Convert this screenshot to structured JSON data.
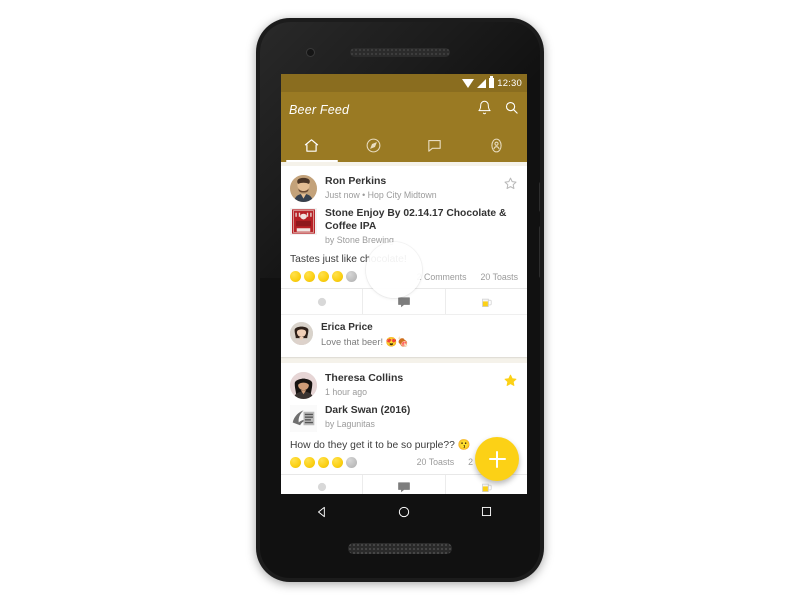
{
  "device": {
    "label": "android-phone-mockup",
    "statusbar": {
      "time": "12:30",
      "icons": [
        "wifi-icon",
        "signal-icon",
        "battery-icon"
      ]
    },
    "navbar": {
      "back": "back-icon",
      "home": "home-icon",
      "recents": "recents-icon"
    }
  },
  "theme": {
    "appbar_color": "#9a7a23",
    "statusbar_color": "#8a6d1f",
    "accent_color": "#fcd116",
    "feed_bg": "#f5f2ea"
  },
  "appbar": {
    "title": "Beer Feed",
    "actions": [
      {
        "name": "notifications-icon",
        "label": "Notifications"
      },
      {
        "name": "search-icon",
        "label": "Search"
      }
    ]
  },
  "tabs": [
    {
      "name": "tab-home",
      "icon": "home-icon",
      "active": true
    },
    {
      "name": "tab-explore",
      "icon": "compass-icon",
      "active": false
    },
    {
      "name": "tab-messages",
      "icon": "chat-bubble-icon",
      "active": false
    },
    {
      "name": "tab-profile",
      "icon": "profile-icon",
      "active": false
    }
  ],
  "posts": [
    {
      "user": "Ron Perkins",
      "meta": "Just now • Hop City Midtown",
      "starred": false,
      "star_icon": "star-outline-icon",
      "beer_name": "Stone Enjoy By 02.14.17 Chocolate & Coffee IPA",
      "beer_by": "by Stone Brewing",
      "body": "Tastes just like chocolate!",
      "rating": 4,
      "rating_max": 5,
      "comments_label": "2 Comments",
      "toasts_label": "20 Toasts",
      "actions": [
        {
          "name": "action-rate",
          "icon": "rate-icon"
        },
        {
          "name": "action-comment",
          "icon": "comment-icon"
        },
        {
          "name": "action-toast",
          "icon": "beer-mug-icon"
        }
      ],
      "comment": {
        "user": "Erica Price",
        "text": "Love that beer! 😍🍖"
      }
    },
    {
      "user": "Theresa Collins",
      "meta": "1 hour ago",
      "starred": true,
      "star_icon": "star-filled-icon",
      "beer_name": "Dark Swan (2016)",
      "beer_by": "by Lagunitas",
      "body": "How do they get it to be so purple?? 😗",
      "rating": 4,
      "rating_max": 5,
      "toasts_label": "20 Toasts",
      "comments_label": "2 Comments",
      "actions": [
        {
          "name": "action-rate",
          "icon": "rate-icon"
        },
        {
          "name": "action-comment",
          "icon": "comment-icon"
        },
        {
          "name": "action-toast",
          "icon": "beer-mug-icon"
        }
      ]
    }
  ],
  "fab": {
    "name": "add-post-fab",
    "icon": "plus-icon",
    "label": "+"
  }
}
